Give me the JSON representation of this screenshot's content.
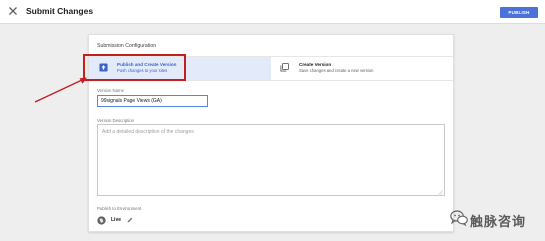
{
  "header": {
    "title": "Submit Changes",
    "publish_label": "PUBLISH",
    "close_icon": "close-icon"
  },
  "card": {
    "title": "Submission Configuration",
    "options": [
      {
        "title": "Publish and Create Version",
        "subtitle": "Push changes to your sites",
        "icon": "publish-upload-icon",
        "selected": true
      },
      {
        "title": "Create Version",
        "subtitle": "Save changes and create a new version",
        "icon": "copy-version-icon",
        "selected": false
      }
    ],
    "version_name_label": "Version Name",
    "version_name_value": "99signals Page Views (GA)",
    "version_description_label": "Version Description",
    "version_description_placeholder": "Add a detailed description of the changes",
    "publish_env_label": "Publish to Environment",
    "env_name": "Live"
  },
  "annotation": {
    "highlight_color": "#c41f1f"
  },
  "watermark": {
    "text": "触脉咨询",
    "icon": "wechat-icon"
  },
  "colors": {
    "accent": "#4a72d9",
    "selected_bg": "#e3ebfb",
    "page_bg": "#eeeeee"
  }
}
